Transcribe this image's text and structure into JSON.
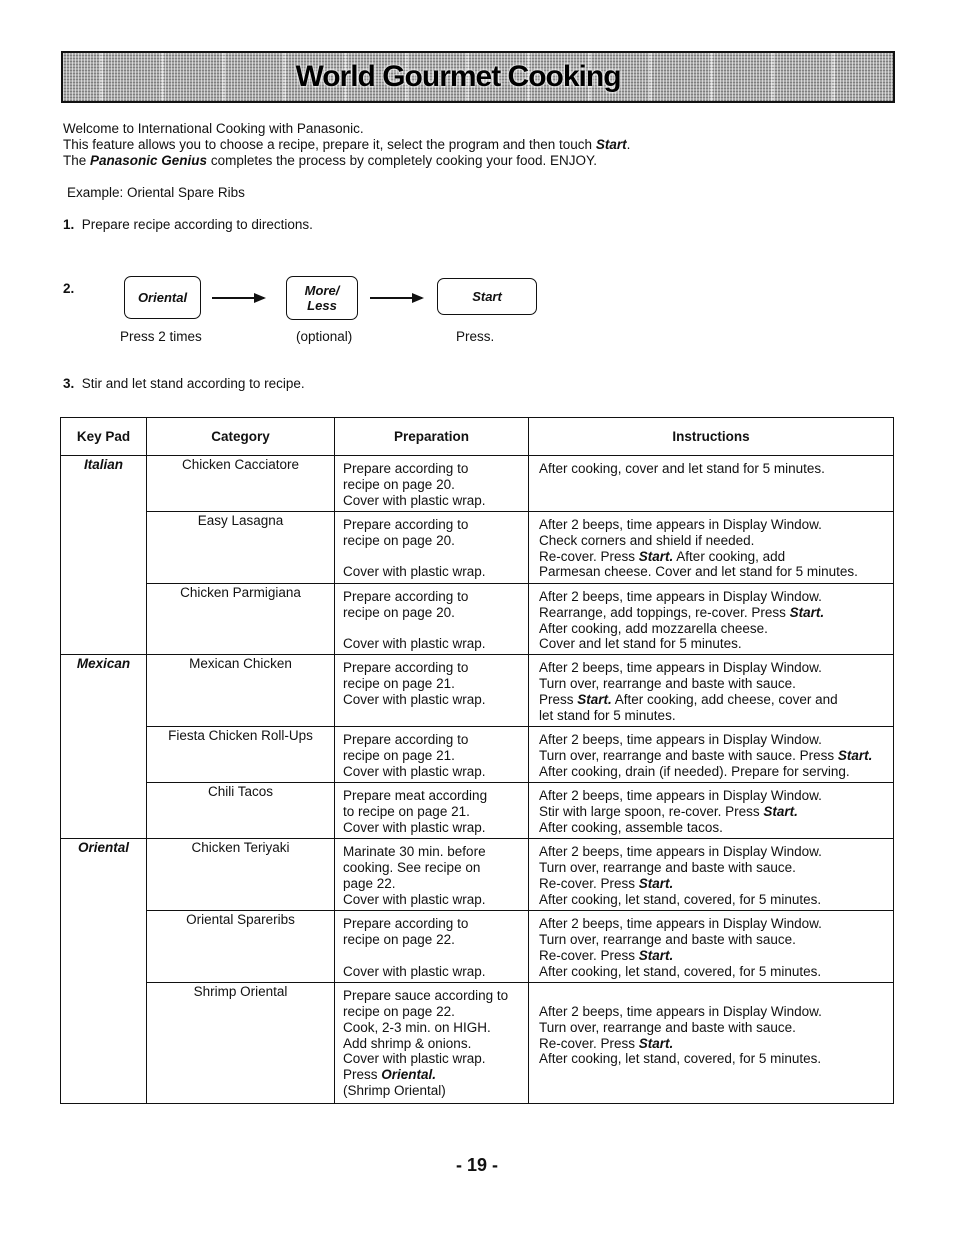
{
  "banner": {
    "title": "World Gourmet Cooking"
  },
  "intro": {
    "line1": "Welcome to International Cooking with Panasonic.",
    "line2_prefix": "This feature allows you to choose a recipe, prepare it, select the program and then touch ",
    "line2_bold": "Start",
    "line2_suffix": ".",
    "line3_prefix": "The ",
    "line3_bold": "Panasonic Genius",
    "line3_suffix": " completes the process by completely cooking your food.  ENJOY."
  },
  "example": "Example: Oriental Spare Ribs",
  "steps": {
    "step1_num": "1.",
    "step1_text": "Prepare recipe according to directions.",
    "step2_num": "2.",
    "step3_num": "3.",
    "step3_text": "Stir and let stand according to recipe."
  },
  "keys": [
    {
      "label": "Oriental",
      "caption": "Press 2 times"
    },
    {
      "label_line1": "More/",
      "label_line2": "Less",
      "caption": "(optional)"
    },
    {
      "label": "Start",
      "caption": "Press."
    }
  ],
  "table": {
    "headers": [
      "Key Pad",
      "Category",
      "Preparation",
      "Instructions"
    ],
    "groups": [
      {
        "keypad": "Italian",
        "rows": [
          {
            "category": "Chicken Cacciatore",
            "preparation": "Prepare according to\nrecipe on page 20.\nCover with plastic wrap.",
            "instructions": "After cooking, cover and let stand for 5 minutes."
          },
          {
            "category": "Easy Lasagna",
            "preparation": "Prepare according to\nrecipe on page 20.\n\nCover with plastic wrap.",
            "instructions": "After 2 beeps, time appears in Display Window.\nCheck corners and shield if needed.\nRe-cover.  Press Start.  After cooking, add\nParmesan cheese.  Cover and let stand for 5 minutes."
          },
          {
            "category": "Chicken Parmigiana",
            "preparation": "Prepare according to\nrecipe on page 20.\n\nCover with plastic wrap.",
            "instructions": "After 2 beeps, time appears in Display Window.\nRearrange, add toppings, re-cover.  Press Start.\nAfter cooking, add mozzarella cheese.\nCover and let stand for 5 minutes."
          }
        ]
      },
      {
        "keypad": "Mexican",
        "rows": [
          {
            "category": "Mexican Chicken",
            "preparation": "Prepare according to\nrecipe on page 21.\nCover with plastic wrap.",
            "instructions": "After 2 beeps, time appears in Display Window.\nTurn over, rearrange and baste with sauce.\nPress Start. After cooking, add cheese, cover and\nlet stand for 5 minutes."
          },
          {
            "category": "Fiesta Chicken Roll-Ups",
            "preparation": "Prepare according to\nrecipe on page 21.\nCover with plastic wrap.",
            "instructions": "After 2 beeps, time appears in Display Window.\nTurn over, rearrange and baste with sauce. Press Start.\nAfter cooking, drain (if needed). Prepare for serving."
          },
          {
            "category": "Chili Tacos",
            "preparation": "Prepare meat according\nto recipe on page 21.\nCover with plastic wrap.",
            "instructions": "After 2 beeps, time appears in Display Window.\nStir with large spoon, re-cover.  Press Start.\nAfter cooking, assemble tacos."
          }
        ]
      },
      {
        "keypad": "Oriental",
        "rows": [
          {
            "category": "Chicken Teriyaki",
            "preparation": "Marinate 30 min. before\ncooking.  See recipe on\npage 22.\nCover with plastic wrap.",
            "instructions": "After 2 beeps, time appears in Display Window.\nTurn over, rearrange and baste with sauce.\nRe-cover.  Press Start.\nAfter cooking, let stand, covered, for 5 minutes."
          },
          {
            "category": "Oriental Spareribs",
            "preparation": "Prepare according to\nrecipe on page 22.\n\nCover with plastic wrap.",
            "instructions": "After 2 beeps, time appears in Display Window.\nTurn over, rearrange and baste with sauce.\nRe-cover.  Press Start.\nAfter cooking, let stand, covered, for 5 minutes."
          },
          {
            "category": "Shrimp Oriental",
            "preparation": "Prepare sauce according to\nrecipe on page 22.\nCook, 2-3 min. on HIGH.\nAdd shrimp & onions.\nCover with plastic wrap.\nPress Oriental.\n(Shrimp Oriental)",
            "instructions": "\nAfter 2 beeps, time appears in Display Window.\nTurn over, rearrange and baste with sauce.\nRe-cover.  Press Start.\nAfter cooking, let stand, covered, for 5 minutes."
          }
        ]
      }
    ]
  },
  "page_number": "- 19 -"
}
